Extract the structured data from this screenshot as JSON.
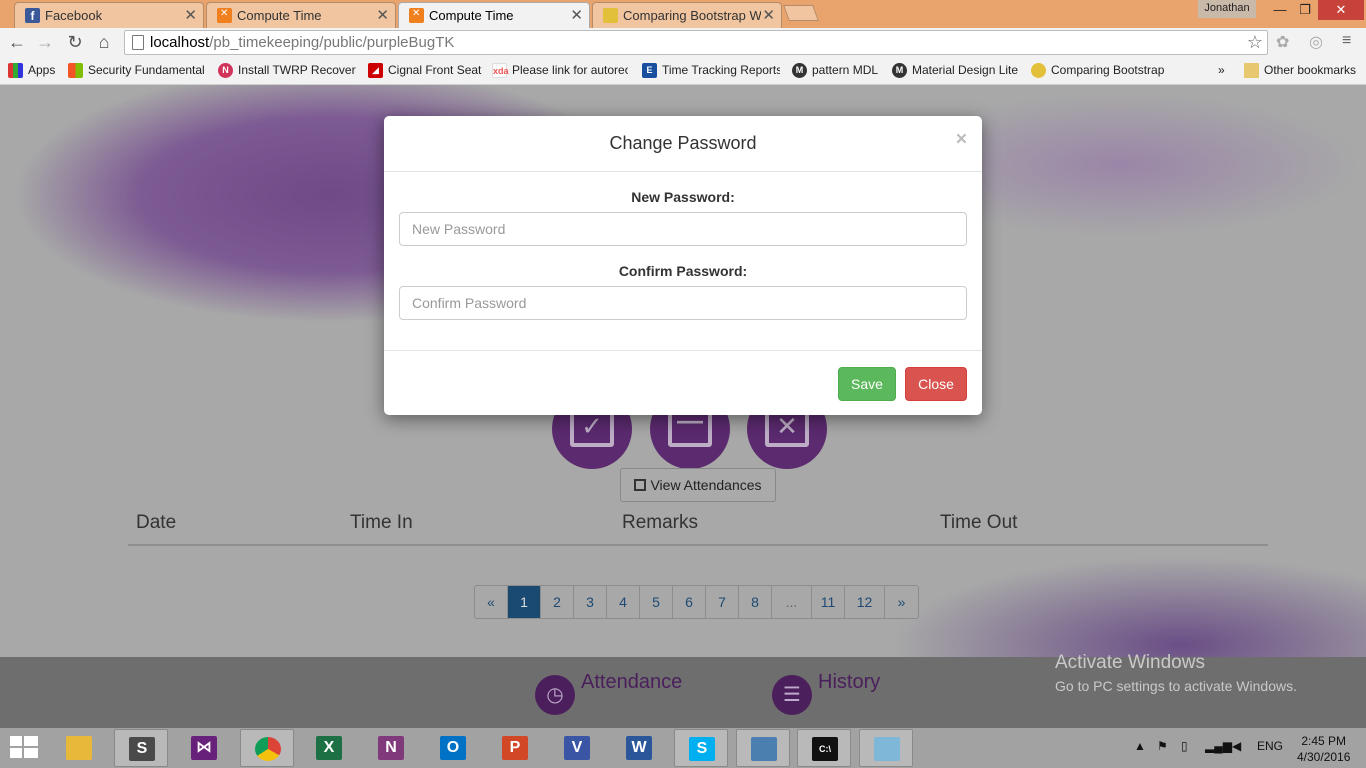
{
  "browser": {
    "tabs": [
      {
        "title": "Facebook",
        "icon": "facebook-icon",
        "active": false
      },
      {
        "title": "Compute Time",
        "icon": "xampp-icon",
        "active": false
      },
      {
        "title": "Compute Time",
        "icon": "xampp-icon",
        "active": true
      },
      {
        "title": "Comparing Bootstrap With",
        "icon": "bootstrap-icon",
        "active": false
      }
    ],
    "user": "Jonathan",
    "url_host": "localhost",
    "url_path": "/pb_timekeeping/public/purpleBugTK",
    "bookmarks": [
      {
        "label": "Apps",
        "icon": "apps-grid-icon",
        "color": "#d33"
      },
      {
        "label": "Security Fundamentals",
        "icon": "microsoft-icon",
        "color": "#f35325"
      },
      {
        "label": "Install TWRP Recovery",
        "icon": "twrp-icon",
        "color": "#d0345b"
      },
      {
        "label": "Cignal Front Seat",
        "icon": "cignal-icon",
        "color": "#c00"
      },
      {
        "label": "Please link for autoreo",
        "icon": "xda-icon",
        "color": "#e88"
      },
      {
        "label": "Time Tracking Reports",
        "icon": "e-icon",
        "color": "#1a4fa0"
      },
      {
        "label": "pattern MDL",
        "icon": "m-icon",
        "color": "#333"
      },
      {
        "label": "Material Design Lite",
        "icon": "m-icon",
        "color": "#333"
      },
      {
        "label": "Comparing Bootstrap",
        "icon": "bootstrap-icon",
        "color": "#e3c03a"
      }
    ],
    "more_bookmarks": "»",
    "other_bookmarks": "Other bookmarks"
  },
  "page": {
    "view_attendances_label": "View Attendances",
    "table_headers": [
      "Date",
      "Time In",
      "Remarks",
      "Time Out"
    ],
    "pagination": [
      "«",
      "1",
      "2",
      "3",
      "4",
      "5",
      "6",
      "7",
      "8",
      "...",
      "11",
      "12",
      "»"
    ],
    "active_page": "1",
    "footer": {
      "attendance": "Attendance",
      "history": "History"
    },
    "watermark": {
      "line1": "Activate Windows",
      "line2": "Go to PC settings to activate Windows."
    }
  },
  "modal": {
    "title": "Change Password",
    "close_symbol": "×",
    "new_password_label": "New Password:",
    "new_password_placeholder": "New Password",
    "confirm_password_label": "Confirm Password:",
    "confirm_password_placeholder": "Confirm Password",
    "save_label": "Save",
    "close_label": "Close"
  },
  "taskbar": {
    "apps": [
      {
        "name": "file-explorer",
        "color": "#e8b83a",
        "glyph": ""
      },
      {
        "name": "sublime-text",
        "color": "#4a4a4a",
        "glyph": "S"
      },
      {
        "name": "visual-studio",
        "color": "#68217a",
        "glyph": "⋈"
      },
      {
        "name": "chrome",
        "color": "#db4437",
        "glyph": ""
      },
      {
        "name": "excel",
        "color": "#1d7044",
        "glyph": "X"
      },
      {
        "name": "onenote",
        "color": "#80397b",
        "glyph": "N"
      },
      {
        "name": "outlook",
        "color": "#0072c6",
        "glyph": "O"
      },
      {
        "name": "powerpoint",
        "color": "#d24726",
        "glyph": "P"
      },
      {
        "name": "visio",
        "color": "#3955a3",
        "glyph": "V"
      },
      {
        "name": "word",
        "color": "#2b579a",
        "glyph": "W"
      },
      {
        "name": "skype",
        "color": "#00aff0",
        "glyph": "S"
      },
      {
        "name": "photos",
        "color": "#4a7fb0",
        "glyph": ""
      },
      {
        "name": "command-prompt",
        "color": "#111",
        "glyph": "C:\\"
      },
      {
        "name": "notepad",
        "color": "#7fb7d9",
        "glyph": ""
      }
    ],
    "language": "ENG",
    "time": "2:45 PM",
    "date": "4/30/2016"
  }
}
